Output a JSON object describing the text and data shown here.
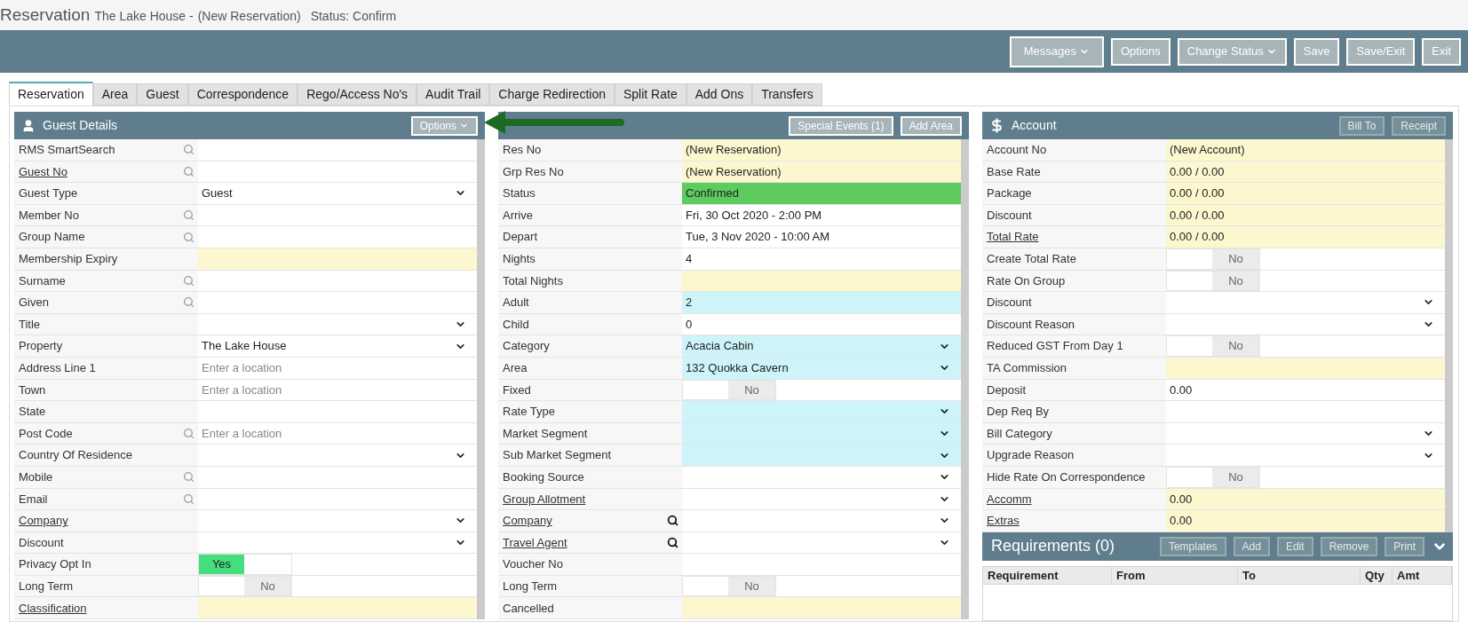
{
  "title": {
    "heading": "Reservation",
    "property": "The Lake House -",
    "reservation": "(New Reservation)",
    "status": "Status: Confirm"
  },
  "toolbar": [
    {
      "label": "Messages",
      "menu": true
    },
    {
      "label": "Options",
      "menu": false
    },
    {
      "label": "Change Status",
      "menu": true
    },
    {
      "label": "Save",
      "menu": false
    },
    {
      "label": "Save/Exit",
      "menu": false
    },
    {
      "label": "Exit",
      "menu": false
    }
  ],
  "tabs": [
    {
      "label": "Reservation",
      "selected": true
    },
    {
      "label": "Area",
      "selected": false
    },
    {
      "label": "Guest",
      "selected": false
    },
    {
      "label": "Correspondence",
      "selected": false
    },
    {
      "label": "Rego/Access No's",
      "selected": false
    },
    {
      "label": "Audit Trail",
      "selected": false
    },
    {
      "label": "Charge Redirection",
      "selected": false
    },
    {
      "label": "Split Rate",
      "selected": false
    },
    {
      "label": "Add Ons",
      "selected": false
    },
    {
      "label": "Transfers",
      "selected": false
    }
  ],
  "guest_details": {
    "title": "Guest Details",
    "buttons": [
      {
        "label": "Options",
        "menu": true,
        "disabled": false
      }
    ],
    "rows": [
      {
        "label": "RMS SmartSearch",
        "link": false,
        "search": true,
        "kind": "text"
      },
      {
        "label": "Guest No",
        "link": true,
        "search": true,
        "kind": "text"
      },
      {
        "label": "Guest Type",
        "link": false,
        "search": false,
        "kind": "select",
        "value": "Guest"
      },
      {
        "label": "Member No",
        "link": false,
        "search": true,
        "kind": "text"
      },
      {
        "label": "Group Name",
        "link": false,
        "search": true,
        "kind": "text"
      },
      {
        "label": "Membership Expiry",
        "link": false,
        "search": false,
        "kind": "text",
        "color": "#fdf7cf"
      },
      {
        "label": "Surname",
        "link": false,
        "search": true,
        "kind": "text"
      },
      {
        "label": "Given",
        "link": false,
        "search": true,
        "kind": "text"
      },
      {
        "label": "Title",
        "link": false,
        "search": false,
        "kind": "select"
      },
      {
        "label": "Property",
        "link": false,
        "search": false,
        "kind": "select",
        "value": "The Lake House"
      },
      {
        "label": "Address Line 1",
        "link": false,
        "search": false,
        "kind": "text",
        "placeholder": "Enter a location"
      },
      {
        "label": "Town",
        "link": false,
        "search": false,
        "kind": "text",
        "placeholder": "Enter a location"
      },
      {
        "label": "State",
        "link": false,
        "search": false,
        "kind": "text"
      },
      {
        "label": "Post Code",
        "link": false,
        "search": true,
        "kind": "text",
        "placeholder": "Enter a location"
      },
      {
        "label": "Country Of Residence",
        "link": false,
        "search": false,
        "kind": "select"
      },
      {
        "label": "Mobile",
        "link": false,
        "search": true,
        "kind": "text"
      },
      {
        "label": "Email",
        "link": false,
        "search": true,
        "kind": "text"
      },
      {
        "label": "Company",
        "link": true,
        "search": false,
        "kind": "select"
      },
      {
        "label": "Discount",
        "link": false,
        "search": false,
        "kind": "select"
      },
      {
        "label": "Privacy Opt In",
        "link": false,
        "search": false,
        "kind": "toggle",
        "on": true,
        "value": "Yes"
      },
      {
        "label": "Long Term",
        "link": false,
        "search": false,
        "kind": "toggle",
        "on": false,
        "value": "No"
      },
      {
        "label": "Classification",
        "link": true,
        "search": false,
        "kind": "text",
        "color": "#fdf7cf"
      }
    ]
  },
  "reservation_details": {
    "buttons": [
      {
        "label": "Special Events (1)",
        "menu": false,
        "disabled": false
      },
      {
        "label": "Add Area",
        "menu": false,
        "disabled": false
      }
    ],
    "rows": [
      {
        "label": "Res No",
        "link": false,
        "search": false,
        "kind": "text",
        "value": "(New Reservation)",
        "color": "#fdf7cf"
      },
      {
        "label": "Grp Res No",
        "link": false,
        "search": false,
        "kind": "text",
        "value": "(New Reservation)",
        "color": "#fdf7cf"
      },
      {
        "label": "Status",
        "link": false,
        "search": false,
        "kind": "text",
        "value": "Confirmed",
        "color": "#5dcb5e"
      },
      {
        "label": "Arrive",
        "link": false,
        "search": false,
        "kind": "text",
        "value": "Fri, 30 Oct 2020 - 2:00 PM"
      },
      {
        "label": "Depart",
        "link": false,
        "search": false,
        "kind": "text",
        "value": "Tue, 3 Nov 2020 - 10:00 AM"
      },
      {
        "label": "Nights",
        "link": false,
        "search": false,
        "kind": "text",
        "value": "4"
      },
      {
        "label": "Total Nights",
        "link": false,
        "search": false,
        "kind": "text",
        "color": "#fdf7cf"
      },
      {
        "label": "Adult",
        "link": false,
        "search": false,
        "kind": "text",
        "value": "2",
        "color": "#cdf5f9"
      },
      {
        "label": "Child",
        "link": false,
        "search": false,
        "kind": "text",
        "value": "0"
      },
      {
        "label": "Category",
        "link": false,
        "search": false,
        "kind": "select",
        "value": "Acacia Cabin",
        "color": "#cdf5f9"
      },
      {
        "label": "Area",
        "link": false,
        "search": false,
        "kind": "select",
        "value": "132 Quokka Cavern",
        "color": "#cdf5f9"
      },
      {
        "label": "Fixed",
        "link": false,
        "search": false,
        "kind": "toggle",
        "on": false,
        "value": "No"
      },
      {
        "label": "Rate Type",
        "link": false,
        "search": false,
        "kind": "select",
        "color": "#cdf5f9"
      },
      {
        "label": "Market Segment",
        "link": false,
        "search": false,
        "kind": "select",
        "color": "#cdf5f9"
      },
      {
        "label": "Sub Market Segment",
        "link": false,
        "search": false,
        "kind": "select",
        "color": "#cdf5f9"
      },
      {
        "label": "Booking Source",
        "link": false,
        "search": false,
        "kind": "select"
      },
      {
        "label": "Group Allotment",
        "link": true,
        "search": false,
        "kind": "select"
      },
      {
        "label": "Company",
        "link": true,
        "search": true,
        "kind": "select"
      },
      {
        "label": "Travel Agent",
        "link": true,
        "search": true,
        "kind": "select"
      },
      {
        "label": "Voucher No",
        "link": false,
        "search": false,
        "kind": "text"
      },
      {
        "label": "Long Term",
        "link": false,
        "search": false,
        "kind": "toggle",
        "on": false,
        "value": "No"
      },
      {
        "label": "Cancelled",
        "link": false,
        "search": false,
        "kind": "text",
        "color": "#fdf7cf"
      }
    ]
  },
  "account": {
    "title": "Account",
    "buttons": [
      {
        "label": "Bill To",
        "menu": false,
        "disabled": true
      },
      {
        "label": "Receipt",
        "menu": false,
        "disabled": true
      }
    ],
    "rows": [
      {
        "label": "Account No",
        "link": false,
        "search": false,
        "kind": "text",
        "value": "(New Account)",
        "color": "#fdf7cf"
      },
      {
        "label": "Base Rate",
        "link": false,
        "search": false,
        "kind": "text",
        "value": "0.00 / 0.00",
        "color": "#fdf7cf"
      },
      {
        "label": "Package",
        "link": false,
        "search": false,
        "kind": "text",
        "value": "0.00 / 0.00",
        "color": "#fdf7cf"
      },
      {
        "label": "Discount",
        "link": false,
        "search": false,
        "kind": "text",
        "value": "0.00 / 0.00",
        "color": "#fdf7cf"
      },
      {
        "label": "Total Rate",
        "link": true,
        "search": false,
        "kind": "text",
        "value": "0.00 / 0.00",
        "color": "#fdf7cf"
      },
      {
        "label": "Create Total Rate",
        "link": false,
        "search": false,
        "kind": "toggle",
        "on": false,
        "value": "No"
      },
      {
        "label": "Rate On Group",
        "link": false,
        "search": false,
        "kind": "toggle",
        "on": false,
        "value": "No"
      },
      {
        "label": "Discount",
        "link": false,
        "search": false,
        "kind": "select"
      },
      {
        "label": "Discount Reason",
        "link": false,
        "search": false,
        "kind": "select"
      },
      {
        "label": "Reduced GST From Day 1",
        "link": false,
        "search": false,
        "kind": "toggle",
        "on": false,
        "value": "No"
      },
      {
        "label": "TA Commission",
        "link": false,
        "search": false,
        "kind": "text",
        "color": "#fdf7cf"
      },
      {
        "label": "Deposit",
        "link": false,
        "search": false,
        "kind": "text",
        "value": "0.00"
      },
      {
        "label": "Dep Req By",
        "link": false,
        "search": false,
        "kind": "text"
      },
      {
        "label": "Bill Category",
        "link": false,
        "search": false,
        "kind": "select"
      },
      {
        "label": "Upgrade Reason",
        "link": false,
        "search": false,
        "kind": "select"
      },
      {
        "label": "Hide Rate On Correspondence",
        "link": false,
        "search": false,
        "kind": "toggle",
        "on": false,
        "value": "No"
      },
      {
        "label": "Accomm",
        "link": true,
        "search": false,
        "kind": "text",
        "value": "0.00",
        "color": "#fdf7cf"
      },
      {
        "label": "Extras",
        "link": true,
        "search": false,
        "kind": "text",
        "value": "0.00",
        "color": "#fdf7cf"
      }
    ]
  },
  "requirements": {
    "title": "Requirements (0)",
    "buttons": [
      {
        "label": "Templates",
        "menu": false,
        "disabled": true
      },
      {
        "label": "Add",
        "menu": false,
        "disabled": true
      },
      {
        "label": "Edit",
        "menu": false,
        "disabled": true
      },
      {
        "label": "Remove",
        "menu": false,
        "disabled": true
      },
      {
        "label": "Print",
        "menu": false,
        "disabled": true
      }
    ],
    "columns": [
      "Requirement",
      "From",
      "To",
      "Qty",
      "Amt"
    ]
  }
}
